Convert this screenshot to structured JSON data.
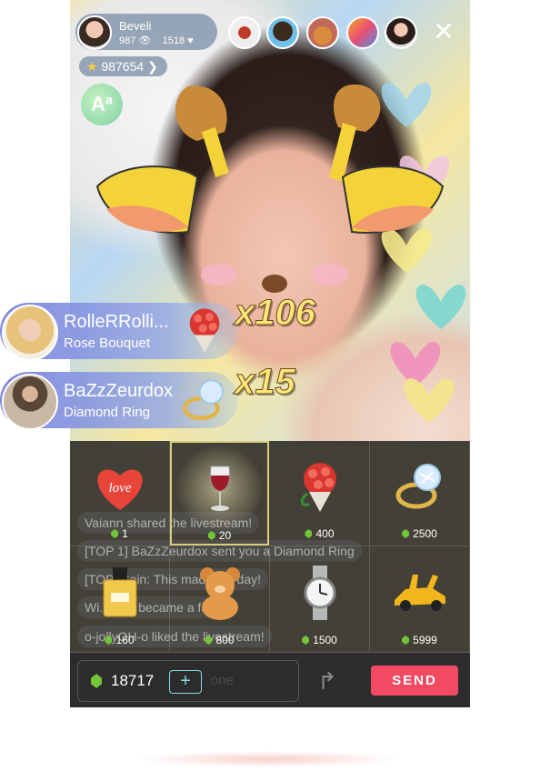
{
  "colors": {
    "send_button": "#f34a63",
    "gem": "#74c43a",
    "plus_outline": "#7fe0d8",
    "multiplier": "#ffe67a",
    "banner": "#7882dc"
  },
  "host": {
    "name": "Beveli",
    "views": "987",
    "likes": "1518",
    "view_icon": "eye-icon",
    "like_icon": "heart-icon"
  },
  "coins": {
    "value": "987654",
    "icon": "star-icon"
  },
  "font_button": {
    "label": "Aª"
  },
  "viewers": [
    {
      "name": "viewer-avatar-1"
    },
    {
      "name": "viewer-avatar-2"
    },
    {
      "name": "viewer-avatar-3"
    },
    {
      "name": "viewer-avatar-4"
    },
    {
      "name": "viewer-avatar-5"
    }
  ],
  "close_label": "✕",
  "gift_banners": [
    {
      "user": "RolleRRolli...",
      "gift": "Rose Bouquet",
      "count": "x106"
    },
    {
      "user": "BaZzZeurdox",
      "gift": "Diamond Ring",
      "count": "x15"
    }
  ],
  "chat": [
    {
      "text": "Vaiann shared the livestream!"
    },
    {
      "text": "[TOP 1] BaZzZeurdox sent you a Diamond Ring"
    },
    {
      "text": "[TOP] Sain: This made my day!"
    },
    {
      "text": "Wi...ham became a fan!"
    },
    {
      "text": "o-jollyOH-o liked the livestream!"
    }
  ],
  "gifts": [
    {
      "name": "Love",
      "price": "1",
      "selected": false
    },
    {
      "name": "Wine",
      "price": "20",
      "selected": true
    },
    {
      "name": "Rose Bouquet",
      "price": "400",
      "selected": false
    },
    {
      "name": "Diamond Ring",
      "price": "2500",
      "selected": false
    },
    {
      "name": "Perfume",
      "price": "160",
      "selected": false
    },
    {
      "name": "Teddy Bear",
      "price": "800",
      "selected": false
    },
    {
      "name": "Watch",
      "price": "1500",
      "selected": false
    },
    {
      "name": "Sports Car",
      "price": "5999",
      "selected": false
    }
  ],
  "love_label": "love",
  "gift_page": {
    "current": 1,
    "total": 2
  },
  "bottom": {
    "balance": "18717",
    "plus_label": "+",
    "send_label": "SEND",
    "input_placeholder": "one"
  }
}
